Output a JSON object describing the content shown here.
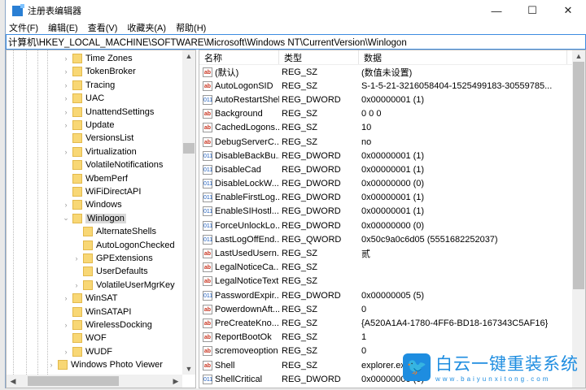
{
  "window": {
    "title": "注册表编辑器",
    "min": "—",
    "max": "☐",
    "close": "✕"
  },
  "menu": [
    "文件(F)",
    "编辑(E)",
    "查看(V)",
    "收藏夹(A)",
    "帮助(H)"
  ],
  "address": "计算机\\HKEY_LOCAL_MACHINE\\SOFTWARE\\Microsoft\\Windows NT\\CurrentVersion\\Winlogon",
  "tree": [
    {
      "label": "Time Zones",
      "level": 1,
      "exp": true
    },
    {
      "label": "TokenBroker",
      "level": 1,
      "exp": true
    },
    {
      "label": "Tracing",
      "level": 1,
      "exp": true
    },
    {
      "label": "UAC",
      "level": 1,
      "exp": true
    },
    {
      "label": "UnattendSettings",
      "level": 1,
      "exp": true
    },
    {
      "label": "Update",
      "level": 1,
      "exp": true
    },
    {
      "label": "VersionsList",
      "level": 1,
      "exp": false
    },
    {
      "label": "Virtualization",
      "level": 1,
      "exp": true
    },
    {
      "label": "VolatileNotifications",
      "level": 1,
      "exp": false
    },
    {
      "label": "WbemPerf",
      "level": 1,
      "exp": false
    },
    {
      "label": "WiFiDirectAPI",
      "level": 1,
      "exp": false
    },
    {
      "label": "Windows",
      "level": 1,
      "exp": true
    },
    {
      "label": "Winlogon",
      "level": 1,
      "exp": "open",
      "selected": true
    },
    {
      "label": "AlternateShells",
      "level": 2,
      "exp": false
    },
    {
      "label": "AutoLogonChecked",
      "level": 2,
      "exp": false
    },
    {
      "label": "GPExtensions",
      "level": 2,
      "exp": true
    },
    {
      "label": "UserDefaults",
      "level": 2,
      "exp": false
    },
    {
      "label": "VolatileUserMgrKey",
      "level": 2,
      "exp": true
    },
    {
      "label": "WinSAT",
      "level": 1,
      "exp": true
    },
    {
      "label": "WinSATAPI",
      "level": 1,
      "exp": false
    },
    {
      "label": "WirelessDocking",
      "level": 1,
      "exp": true
    },
    {
      "label": "WOF",
      "level": 1,
      "exp": false
    },
    {
      "label": "WUDF",
      "level": 1,
      "exp": true
    },
    {
      "label": "Windows Photo Viewer",
      "level": 0,
      "exp": true
    }
  ],
  "columns": [
    "名称",
    "类型",
    "数据"
  ],
  "values": [
    {
      "name": "(默认)",
      "type": "REG_SZ",
      "data": "(数值未设置)"
    },
    {
      "name": "AutoLogonSID",
      "type": "REG_SZ",
      "data": "S-1-5-21-3216058404-1525499183-30559785..."
    },
    {
      "name": "AutoRestartShell",
      "type": "REG_DWORD",
      "data": "0x00000001 (1)"
    },
    {
      "name": "Background",
      "type": "REG_SZ",
      "data": "0 0 0"
    },
    {
      "name": "CachedLogons...",
      "type": "REG_SZ",
      "data": "10"
    },
    {
      "name": "DebugServerC...",
      "type": "REG_SZ",
      "data": "no"
    },
    {
      "name": "DisableBackBu...",
      "type": "REG_DWORD",
      "data": "0x00000001 (1)"
    },
    {
      "name": "DisableCad",
      "type": "REG_DWORD",
      "data": "0x00000001 (1)"
    },
    {
      "name": "DisableLockW...",
      "type": "REG_DWORD",
      "data": "0x00000000 (0)"
    },
    {
      "name": "EnableFirstLog...",
      "type": "REG_DWORD",
      "data": "0x00000001 (1)"
    },
    {
      "name": "EnableSIHostl...",
      "type": "REG_DWORD",
      "data": "0x00000001 (1)"
    },
    {
      "name": "ForceUnlockLo...",
      "type": "REG_DWORD",
      "data": "0x00000000 (0)"
    },
    {
      "name": "LastLogOffEnd...",
      "type": "REG_QWORD",
      "data": "0x50c9a0c6d05 (5551682252037)"
    },
    {
      "name": "LastUsedUsern...",
      "type": "REG_SZ",
      "data": "贰"
    },
    {
      "name": "LegalNoticeCa...",
      "type": "REG_SZ",
      "data": ""
    },
    {
      "name": "LegalNoticeText",
      "type": "REG_SZ",
      "data": ""
    },
    {
      "name": "PasswordExpir...",
      "type": "REG_DWORD",
      "data": "0x00000005 (5)"
    },
    {
      "name": "PowerdownAft...",
      "type": "REG_SZ",
      "data": "0"
    },
    {
      "name": "PreCreateKno...",
      "type": "REG_SZ",
      "data": "{A520A1A4-1780-4FF6-BD18-167343C5AF16}"
    },
    {
      "name": "ReportBootOk",
      "type": "REG_SZ",
      "data": "1"
    },
    {
      "name": "scremoveoption",
      "type": "REG_SZ",
      "data": "0"
    },
    {
      "name": "Shell",
      "type": "REG_SZ",
      "data": "explorer.exe"
    },
    {
      "name": "ShellCritical",
      "type": "REG_DWORD",
      "data": "0x00000000 (0)"
    }
  ],
  "watermark": {
    "name": "白云一键重装系统",
    "url": "www.baiyunxitong.com"
  }
}
